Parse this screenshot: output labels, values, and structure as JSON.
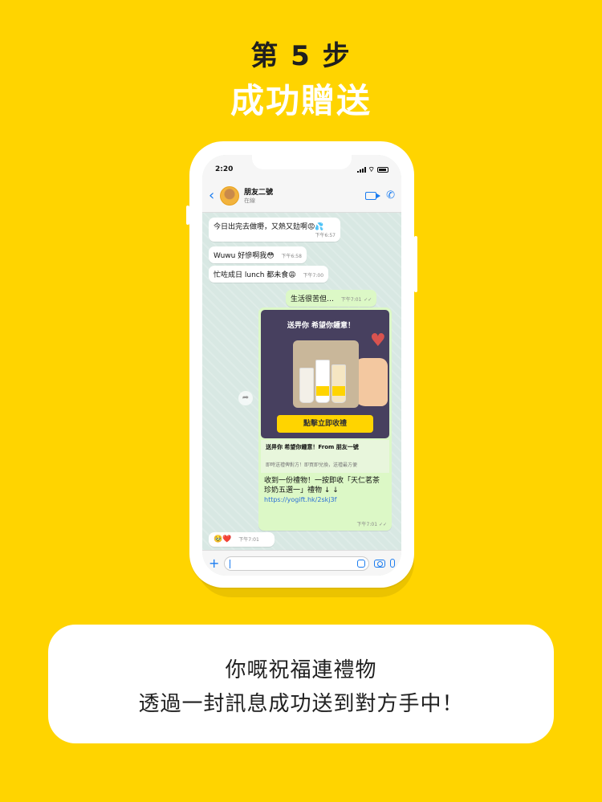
{
  "header": {
    "step": "第 5 步",
    "subtitle": "成功贈送"
  },
  "phone": {
    "status_time": "2:20",
    "contact_name": "朋友二號",
    "contact_status": "在線",
    "messages": [
      {
        "text": "今日出完去做嘢，又熱又攰啊😡💦",
        "time": "下午6:57",
        "dir": "in"
      },
      {
        "text": "Wuwu 好慘啊我😳",
        "time": "下午6:58",
        "dir": "in"
      },
      {
        "text": "忙咗成日 lunch 都未食😩",
        "time": "下午7:00",
        "dir": "in"
      },
      {
        "text": "生活很苦但…",
        "time": "下午7:01",
        "dir": "out"
      }
    ],
    "gift": {
      "banner_title": "送畀你 希望你鍾意！",
      "button_label": "點擊立即收禮",
      "caption_title": "送畀你 希望你鍾意！From 朋友一號",
      "caption_sub": "即時送禮俾對方！即買即兌換，送禮最方便",
      "message_text": "收到一份禮物！一按即收「天仁茗茶珍奶五選一」禮物 ↓ ↓",
      "link": "https://yogift.hk/2skj3f",
      "time": "下午7:01"
    },
    "reply": {
      "text": "🥹❤️",
      "time": "下午7:01"
    }
  },
  "info": {
    "line1": "你嘅祝福連禮物",
    "line2": "透過一封訊息成功送到對方手中！"
  }
}
